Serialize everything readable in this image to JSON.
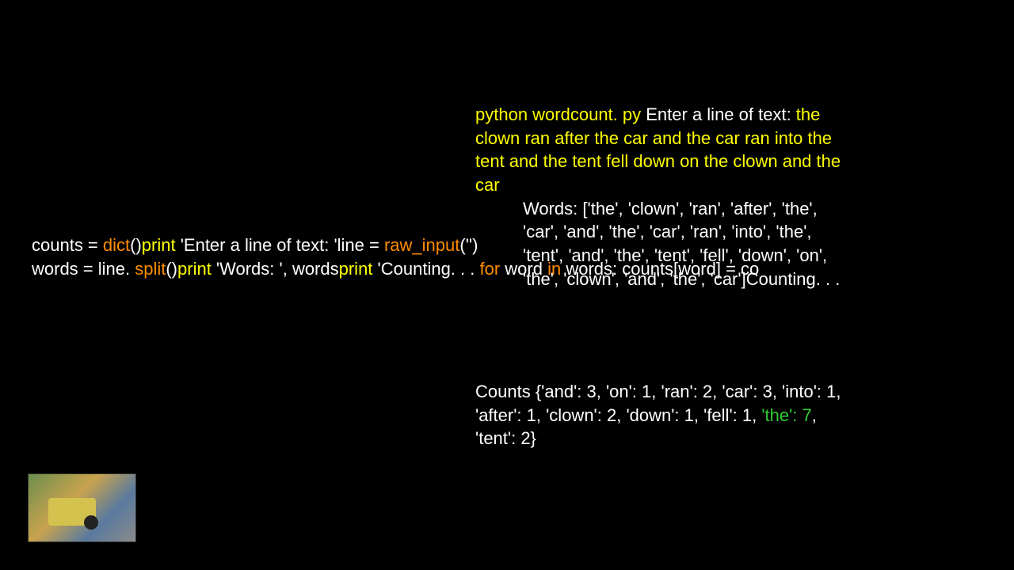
{
  "right": {
    "l1a": "python wordcount. py ",
    "l1b": "Enter a line of text: ",
    "l1c": "the clown ran after the car and the car ran into the tent and the tent fell down on the clown and the car",
    "words_label": "Words: ",
    "words_list": "['the', 'clown', 'ran', 'after', 'the', 'car', 'and', 'the', 'car', 'ran', 'into', 'the', 'tent', 'and', 'the', 'tent', 'fell', 'down', 'on', 'the', 'clown', 'and', 'the', 'car']",
    "counting": "Counting. . ."
  },
  "left": {
    "a1": "counts = ",
    "a2": "dict",
    "a3": "()",
    "a4": "print",
    "a5": " 'Enter a line of text: '",
    "a6": "line = ",
    "a7": "raw_input",
    "a8": "('')",
    "b1": "words = line. ",
    "b2": "split",
    "b3": "()",
    "b4": "print",
    "b5": " 'Words: ', words",
    "b6": "print",
    "b7": " 'Counting. . . ",
    "b8": "for",
    "b9": " word ",
    "b10": "in",
    "b11": " words:    counts[word] = co"
  },
  "counts": {
    "pre": "Counts {'and': 3, 'on': 1, 'ran': 2, 'car': 3, 'into': 1, 'after': 1, 'clown': 2, 'down': 1, 'fell': 1, ",
    "hi": "'the': 7",
    "post": ", 'tent': 2}"
  }
}
